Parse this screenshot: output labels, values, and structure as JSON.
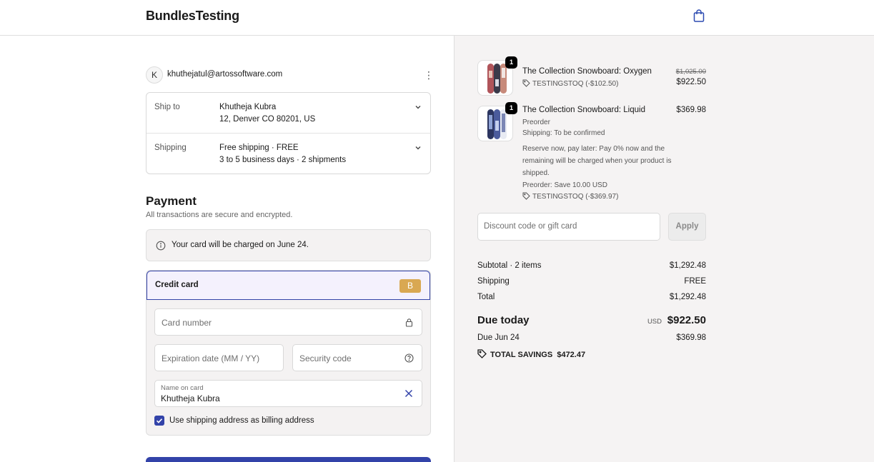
{
  "header": {
    "brand": "BundlesTesting"
  },
  "account": {
    "initial": "K",
    "email": "khuthejatul@artossoftware.com"
  },
  "review": {
    "ship_to": {
      "label": "Ship to",
      "name": "Khutheja Kubra",
      "address": "12, Denver CO 80201, US"
    },
    "shipping": {
      "label": "Shipping",
      "method": "Free shipping · FREE",
      "detail": "3 to 5 business days · 2 shipments"
    }
  },
  "payment": {
    "title": "Payment",
    "subtitle": "All transactions are secure and encrypted.",
    "notice": "Your card will be charged on June 24.",
    "credit_card_label": "Credit card",
    "badge": "B",
    "card_number_placeholder": "Card number",
    "expiration_placeholder": "Expiration date (MM / YY)",
    "security_placeholder": "Security code",
    "name_label": "Name on card",
    "name_value": "Khutheja Kubra",
    "billing_checkbox_label": "Use shipping address as billing address",
    "billing_checked": true
  },
  "order": {
    "items": [
      {
        "qty": "1",
        "name": "The Collection Snowboard: Oxygen",
        "discount": "TESTINGSTOQ (-$102.50)",
        "original_price": "$1,025.00",
        "price": "$922.50"
      },
      {
        "qty": "1",
        "name": "The Collection Snowboard: Liquid",
        "preorder": "Preorder",
        "shipping_note": "Shipping: To be confirmed",
        "reserve_note": "Reserve now, pay later: Pay 0% now and the remaining will be charged when your product is shipped.",
        "preorder_save": "Preorder: Save 10.00 USD",
        "discount": "TESTINGSTOQ (-$369.97)",
        "price": "$369.98"
      }
    ],
    "discount_placeholder": "Discount code or gift card",
    "apply_label": "Apply",
    "summary": {
      "subtotal_label": "Subtotal · 2 items",
      "subtotal": "$1,292.48",
      "shipping_label": "Shipping",
      "shipping": "FREE",
      "total_label": "Total",
      "total": "$1,292.48",
      "due_today_label": "Due today",
      "currency": "USD",
      "due_today": "$922.50",
      "due_later_label": "Due Jun 24",
      "due_later": "$369.98",
      "savings_label": "TOTAL SAVINGS",
      "savings": "$472.47"
    }
  },
  "colors": {
    "accent": "#3343a9",
    "badge": "#d9a852",
    "panel": "#f5f3f3"
  }
}
